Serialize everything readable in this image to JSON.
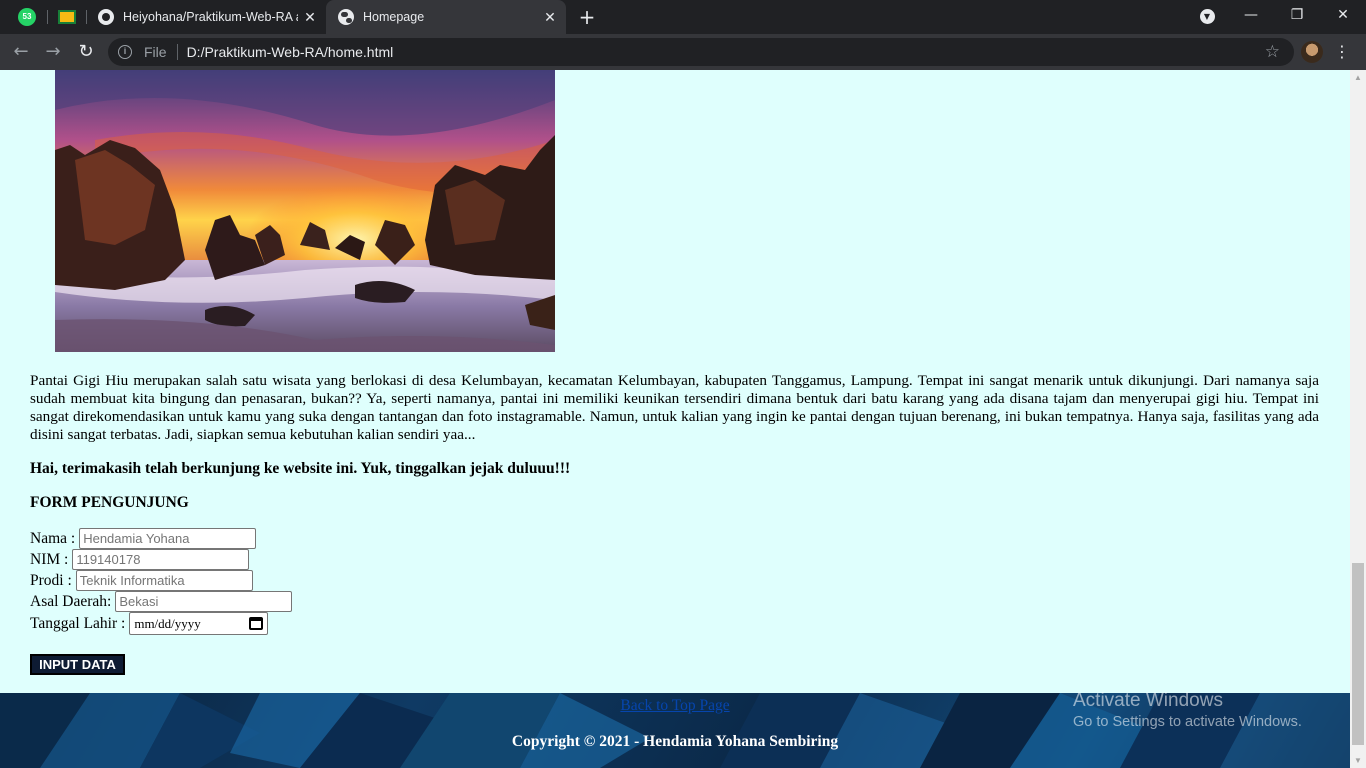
{
  "browser": {
    "tabs": [
      {
        "title": "",
        "badge": "53",
        "icon": "whatsapp-icon"
      },
      {
        "title": "",
        "icon": "google-classroom-icon"
      },
      {
        "title": "Heiyohana/Praktikum-Web-RA at",
        "icon": "github-icon"
      },
      {
        "title": "Homepage",
        "icon": "globe-icon",
        "active": true
      }
    ],
    "address": {
      "scheme": "File",
      "path": "D:/Praktikum-Web-RA/home.html"
    }
  },
  "page": {
    "article": "Pantai Gigi Hiu merupakan salah satu wisata yang berlokasi di desa Kelumbayan, kecamatan Kelumbayan, kabupaten Tanggamus, Lampung. Tempat ini sangat menarik untuk dikunjungi. Dari namanya saja sudah membuat kita bingung dan penasaran, bukan?? Ya, seperti namanya, pantai ini memiliki keunikan tersendiri dimana bentuk dari batu karang yang ada disana tajam dan menyerupai gigi hiu. Tempat ini sangat direkomendasikan untuk kamu yang suka dengan tantangan dan foto instagramable. Namun, untuk kalian yang ingin ke pantai dengan tujuan berenang, ini bukan tempatnya. Hanya saja, fasilitas yang ada disini sangat terbatas. Jadi, siapkan semua kebutuhan kalian sendiri yaa...",
    "greeting": "Hai, terimakasih telah berkunjung ke website ini. Yuk, tinggalkan jejak duluuu!!!",
    "form": {
      "title": "FORM PENGUNJUNG",
      "nama_label": "Nama :",
      "nama_placeholder": "Hendamia Yohana",
      "nim_label": "NIM :",
      "nim_placeholder": "119140178",
      "prodi_label": "Prodi :",
      "prodi_placeholder": "Teknik Informatika",
      "asal_label": "Asal Daerah:",
      "asal_placeholder": "Bekasi",
      "tanggal_label": "Tanggal Lahir :",
      "tanggal_placeholder": "mm/dd/yyyy",
      "submit_label": "INPUT DATA"
    },
    "footer": {
      "top_link": "Back to Top Page",
      "copyright": "Copyright © 2021 - Hendamia Yohana Sembiring"
    }
  },
  "watermark": {
    "line1": "Activate Windows",
    "line2": "Go to Settings to activate Windows."
  }
}
